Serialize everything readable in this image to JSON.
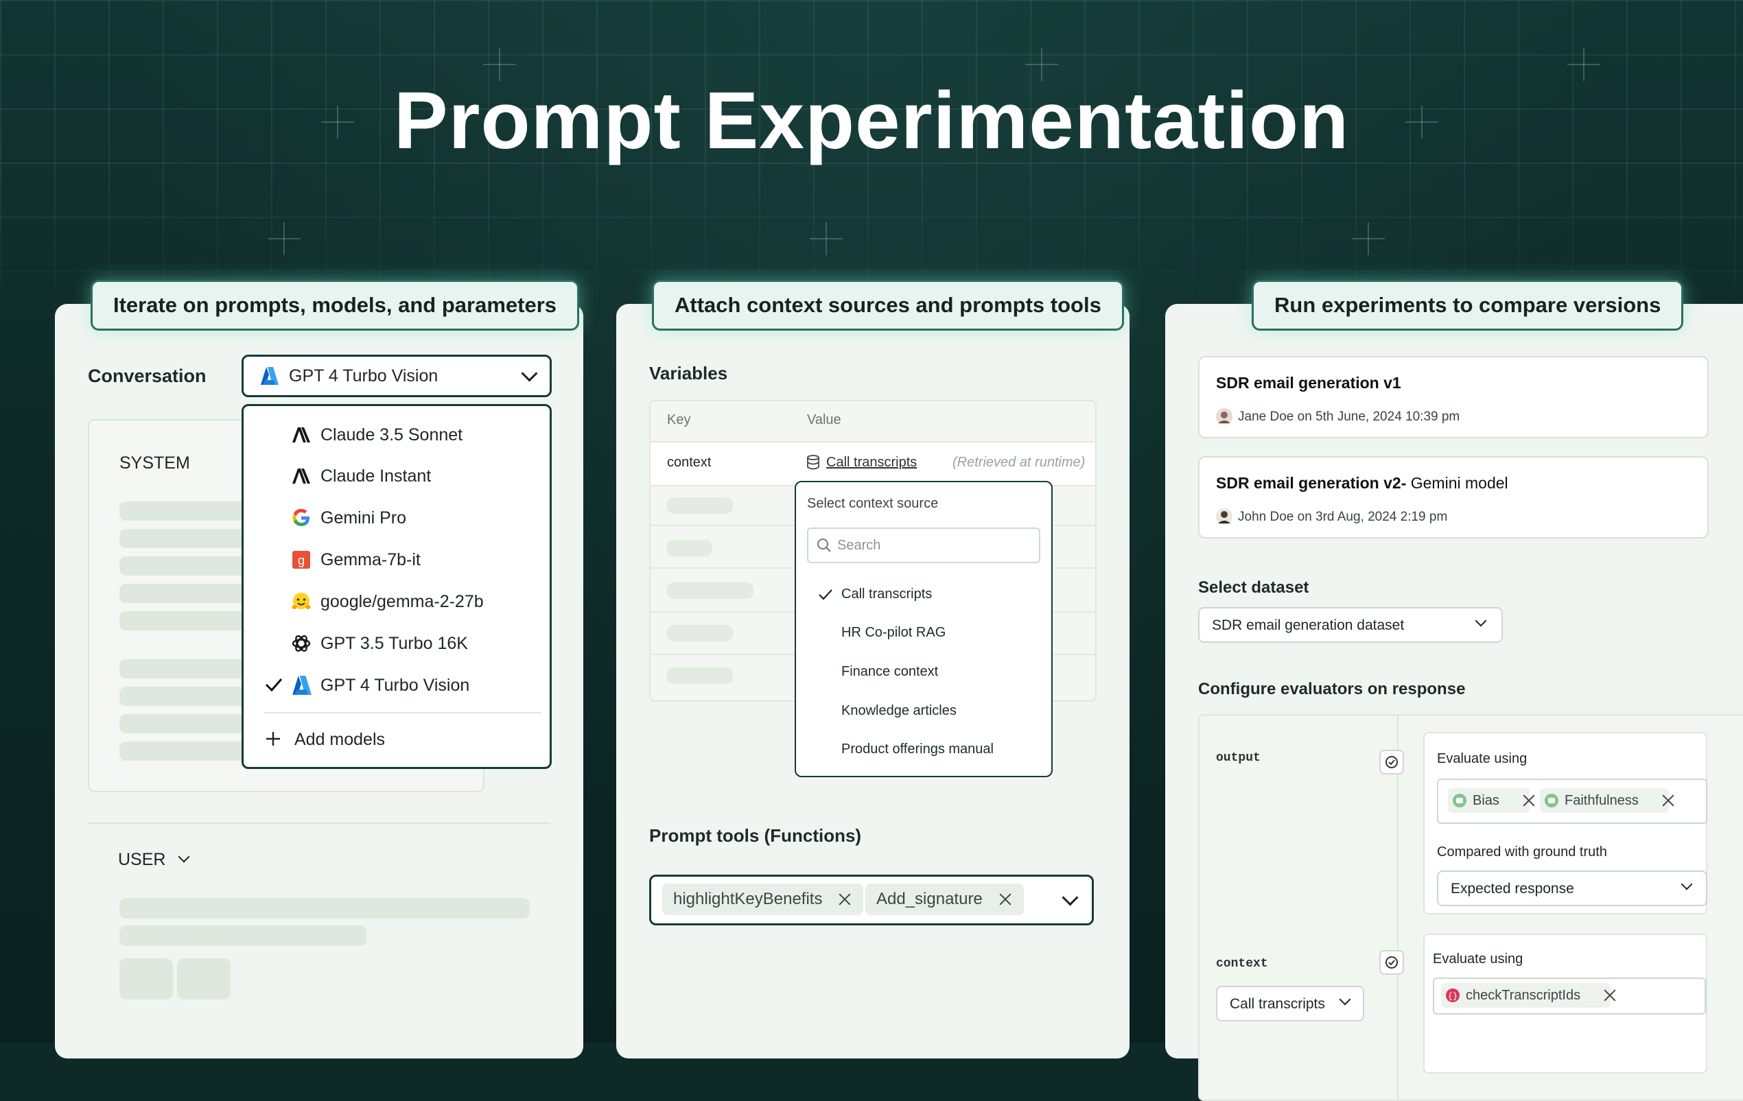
{
  "page": {
    "title": "Prompt Experimentation"
  },
  "panels": {
    "left": {
      "label": "Iterate on prompts, models, and parameters",
      "conversation_label": "Conversation",
      "model_select": {
        "value": "GPT 4 Turbo Vision",
        "icon": "azure-icon"
      },
      "system_label": "SYSTEM",
      "user_label": "USER",
      "model_menu": {
        "items": [
          {
            "label": "Claude 3.5 Sonnet",
            "icon": "anthropic-icon",
            "selected": false
          },
          {
            "label": "Claude Instant",
            "icon": "anthropic-icon",
            "selected": false
          },
          {
            "label": "Gemini Pro",
            "icon": "google-icon",
            "selected": false
          },
          {
            "label": "Gemma-7b-it",
            "icon": "gemma-icon",
            "selected": false
          },
          {
            "label": "google/gemma-2-27b",
            "icon": "huggingface-icon",
            "selected": false
          },
          {
            "label": "GPT 3.5 Turbo 16K",
            "icon": "openai-icon",
            "selected": false
          },
          {
            "label": "GPT 4 Turbo Vision",
            "icon": "azure-icon",
            "selected": true
          }
        ],
        "add_label": "Add models"
      }
    },
    "middle": {
      "label": "Attach context sources and prompts tools",
      "variables_title": "Variables",
      "table": {
        "headers": {
          "key": "Key",
          "value": "Value"
        },
        "row": {
          "key": "context",
          "value": "Call transcripts",
          "note": "(Retrieved at runtime)"
        }
      },
      "context_menu": {
        "title": "Select context source",
        "search_placeholder": "Search",
        "options": [
          {
            "label": "Call transcripts",
            "checked": true
          },
          {
            "label": "HR Co-pilot RAG",
            "checked": false
          },
          {
            "label": "Finance context",
            "checked": false
          },
          {
            "label": "Knowledge articles",
            "checked": false
          },
          {
            "label": "Product offerings manual",
            "checked": false
          }
        ]
      },
      "tools_title": "Prompt tools (Functions)",
      "tools": [
        "highlightKeyBenefits",
        "Add_signature"
      ]
    },
    "right": {
      "label": "Run experiments to compare versions",
      "versions": [
        {
          "title": "SDR email generation v1",
          "suffix": "",
          "author": "Jane Doe",
          "meta": "on 5th June, 2024 10:39 pm"
        },
        {
          "title": "SDR email generation v2-",
          "suffix": " Gemini model",
          "author": "John Doe",
          "meta": "on 3rd Aug, 2024 2:19 pm"
        }
      ],
      "dataset_label": "Select dataset",
      "dataset_value": "SDR email generation dataset",
      "evaluators_title": "Configure evaluators on response",
      "eval_output": {
        "field": "output",
        "evaluate_label": "Evaluate using",
        "chips": [
          "Bias",
          "Faithfulness"
        ],
        "compared_label": "Compared with ground truth",
        "compared_value": "Expected response"
      },
      "eval_context": {
        "field": "context",
        "select_value": "Call transcripts",
        "evaluate_label": "Evaluate using",
        "chips": [
          "checkTranscriptIds"
        ]
      }
    }
  },
  "colors": {
    "background": "#0d2a28",
    "accent": "#2f6d62",
    "panel": "#f1f5f1",
    "chip_green": "#6bbf7f",
    "chip_red": "#d9375b"
  }
}
